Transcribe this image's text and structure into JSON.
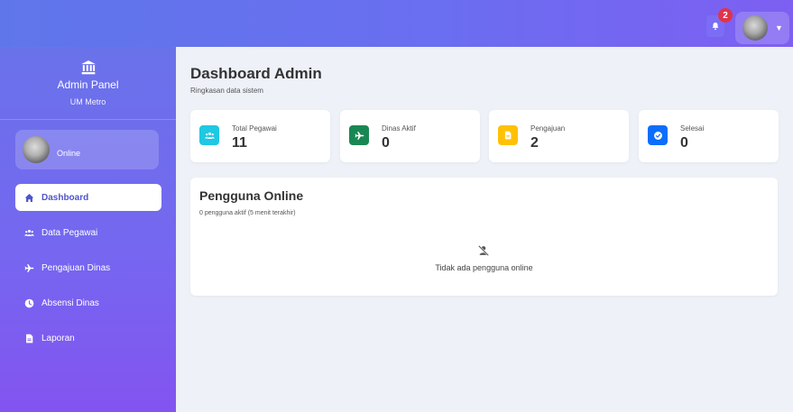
{
  "topbar": {
    "notification_count": "2",
    "icons": {
      "bell": "bell-icon",
      "caret": "caret-down-icon"
    }
  },
  "sidebar": {
    "brand_title": "Admin Panel",
    "brand_subtitle": "UM Metro",
    "brand_icon": "institution-icon",
    "user_status": "Online",
    "items": [
      {
        "label": "Dashboard",
        "icon": "home-icon",
        "active": true
      },
      {
        "label": "Data Pegawai",
        "icon": "users-icon",
        "active": false
      },
      {
        "label": "Pengajuan Dinas",
        "icon": "plane-icon",
        "active": false
      },
      {
        "label": "Absensi Dinas",
        "icon": "clock-icon",
        "active": false
      },
      {
        "label": "Laporan",
        "icon": "file-icon",
        "active": false
      }
    ]
  },
  "main": {
    "title": "Dashboard Admin",
    "subtitle": "Ringkasan data sistem",
    "stats": [
      {
        "label": "Total Pegawai",
        "value": "11",
        "color": "#1fc8e3",
        "icon": "users-icon"
      },
      {
        "label": "Dinas Aktif",
        "value": "0",
        "color": "#198754",
        "icon": "plane-icon"
      },
      {
        "label": "Pengajuan",
        "value": "2",
        "color": "#ffc107",
        "icon": "file-icon"
      },
      {
        "label": "Selesai",
        "value": "0",
        "color": "#0d6efd",
        "icon": "check-circle-icon"
      }
    ],
    "online_users": {
      "title": "Pengguna Online",
      "subtitle": "0 pengguna aktif (5 menit terakhir)",
      "empty_text": "Tidak ada pengguna online",
      "empty_icon": "user-slash-icon"
    }
  },
  "colors": {
    "accent": "#6a6ef0",
    "sidebar_top": "#6a72ea",
    "sidebar_bottom": "#8354f0",
    "badge": "#e0344b",
    "active_text": "#4e55c8"
  }
}
